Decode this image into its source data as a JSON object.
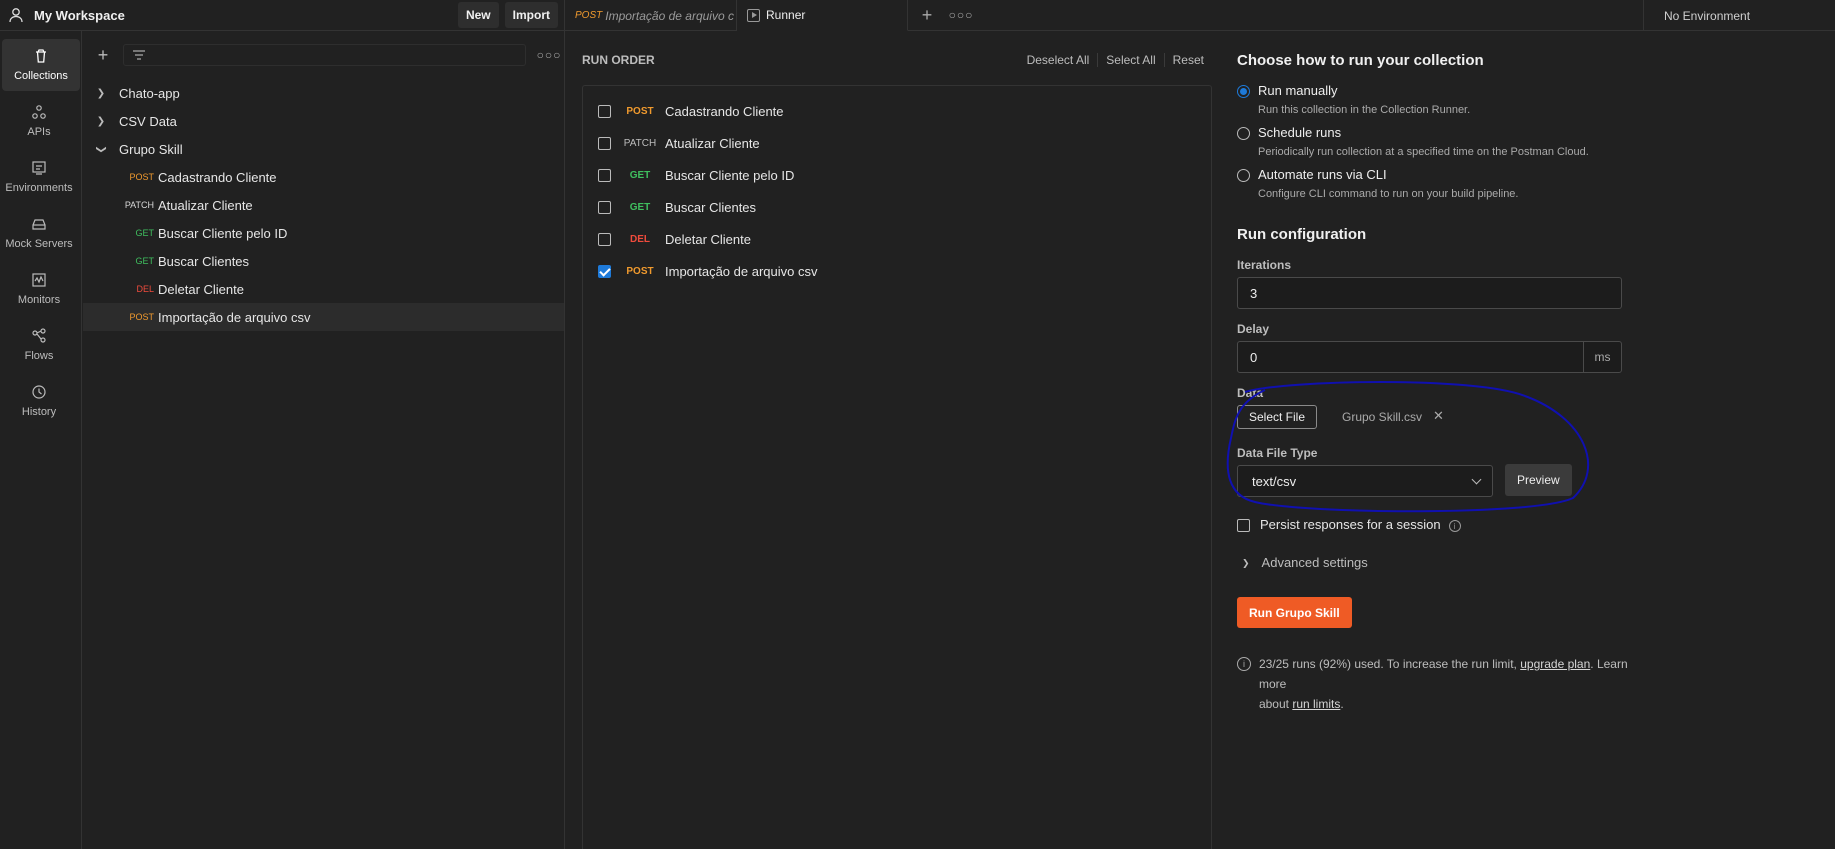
{
  "workspace": {
    "title": "My Workspace",
    "new_label": "New",
    "import_label": "Import"
  },
  "tabs": [
    {
      "method": "POST",
      "label": "Importação de arquivo c"
    },
    {
      "label": "Runner"
    }
  ],
  "environment": "No Environment",
  "rail": [
    {
      "label": "Collections",
      "icon": "trash-can-icon"
    },
    {
      "label": "APIs",
      "icon": "apis-icon"
    },
    {
      "label": "Environments",
      "icon": "environments-icon"
    },
    {
      "label": "Mock Servers",
      "icon": "mock-servers-icon"
    },
    {
      "label": "Monitors",
      "icon": "monitors-icon"
    },
    {
      "label": "Flows",
      "icon": "flows-icon"
    },
    {
      "label": "History",
      "icon": "history-icon"
    }
  ],
  "tree": {
    "collections": [
      "Chato-app",
      "CSV Data",
      "Grupo Skill"
    ],
    "requests": [
      {
        "method": "POST",
        "name": "Cadastrando Cliente"
      },
      {
        "method": "PATCH",
        "name": "Atualizar Cliente"
      },
      {
        "method": "GET",
        "name": "Buscar Cliente pelo ID"
      },
      {
        "method": "GET",
        "name": "Buscar Clientes"
      },
      {
        "method": "DEL",
        "name": "Deletar Cliente"
      },
      {
        "method": "POST",
        "name": "Importação de arquivo csv"
      }
    ]
  },
  "run_order": {
    "title": "RUN ORDER",
    "deselect_all": "Deselect All",
    "select_all": "Select All",
    "reset": "Reset",
    "items": [
      {
        "method": "POST",
        "name": "Cadastrando Cliente",
        "checked": false
      },
      {
        "method": "PATCH",
        "name": "Atualizar Cliente",
        "checked": false
      },
      {
        "method": "GET",
        "name": "Buscar Cliente pelo ID",
        "checked": false
      },
      {
        "method": "GET",
        "name": "Buscar Clientes",
        "checked": false
      },
      {
        "method": "DEL",
        "name": "Deletar Cliente",
        "checked": false
      },
      {
        "method": "POST",
        "name": "Importação de arquivo csv",
        "checked": true
      }
    ]
  },
  "config": {
    "choose_title": "Choose how to run your collection",
    "options": [
      {
        "title": "Run manually",
        "desc": "Run this collection in the Collection Runner."
      },
      {
        "title": "Schedule runs",
        "desc": "Periodically run collection at a specified time on the Postman Cloud."
      },
      {
        "title": "Automate runs via CLI",
        "desc": "Configure CLI command to run on your build pipeline."
      }
    ],
    "run_config_title": "Run configuration",
    "iterations_label": "Iterations",
    "iterations_value": "3",
    "delay_label": "Delay",
    "delay_value": "0",
    "delay_unit": "ms",
    "data_label": "Data",
    "select_file": "Select File",
    "file_name": "Grupo Skill.csv",
    "data_file_type_label": "Data File Type",
    "data_file_type_value": "text/csv",
    "preview": "Preview",
    "persist_label": "Persist responses for a session",
    "advanced": "Advanced settings",
    "run_button": "Run Grupo Skill",
    "info_part1": "23/25 runs (92%) used. To increase the run limit,",
    "info_link1": "upgrade plan",
    "info_part2": ". Learn more",
    "info_part3": "about",
    "info_link2": "run limits",
    "info_part4": "."
  },
  "colors": {
    "post": "#f09a2e",
    "get": "#3fbf5f",
    "del": "#ef4b3c",
    "patch": "#cfcfcf",
    "accent": "#ef5b25",
    "annotation": "#1010b0"
  }
}
